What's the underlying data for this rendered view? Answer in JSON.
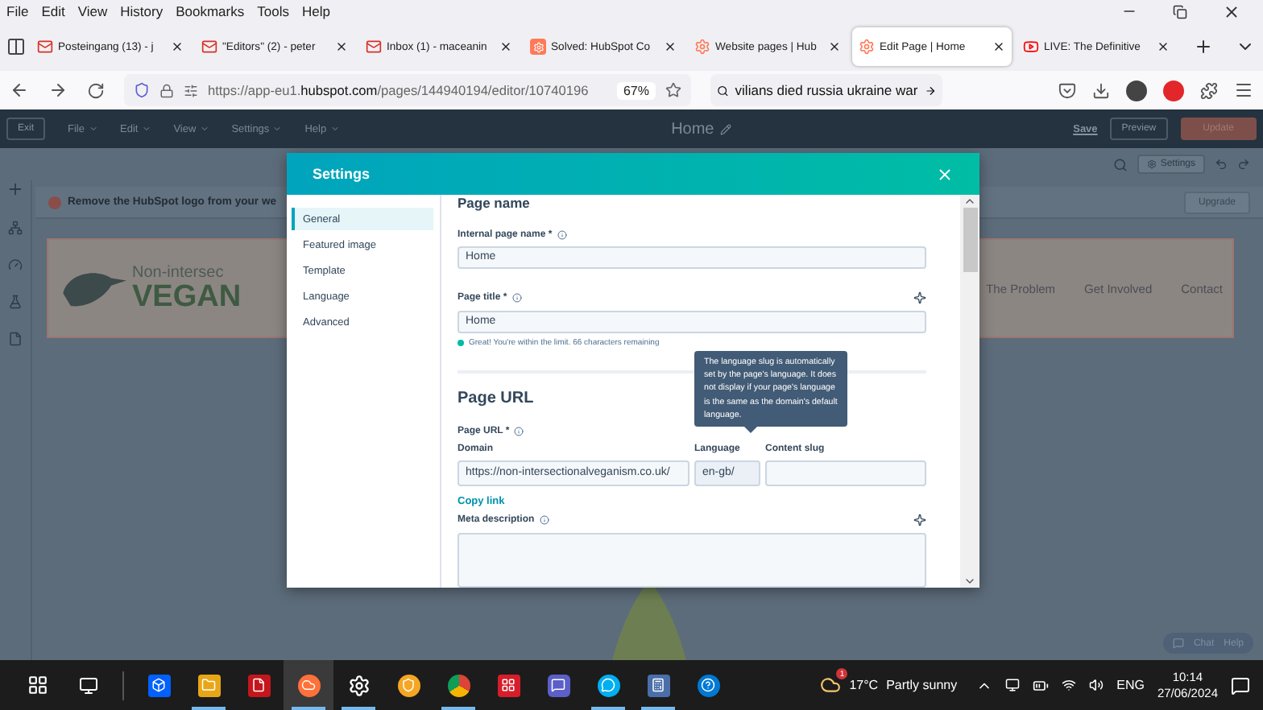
{
  "browser_menu": [
    "File",
    "Edit",
    "View",
    "History",
    "Bookmarks",
    "Tools",
    "Help"
  ],
  "tabs": [
    {
      "kind": "mail",
      "title": "Posteingang (13) - j",
      "selected": false
    },
    {
      "kind": "mail",
      "title": "\"Editors\" (2) - peter",
      "selected": false
    },
    {
      "kind": "mail",
      "title": "Inbox (1) - maceanin",
      "selected": false
    },
    {
      "kind": "hubspot-square",
      "title": "Solved: HubSpot Co",
      "selected": false
    },
    {
      "kind": "hubspot",
      "title": "Website pages | Hub",
      "selected": false
    },
    {
      "kind": "hubspot",
      "title": "Edit Page | Home",
      "selected": true
    },
    {
      "kind": "video",
      "title": "LIVE: The Definitive",
      "selected": false
    }
  ],
  "address_bar": {
    "prefix": "https://app-eu1.",
    "domain": "hubspot.com",
    "path": "/pages/144940194/editor/10740196",
    "zoom": "67%"
  },
  "search_field": {
    "value": "vilians died russia ukraine war"
  },
  "editor_toolbar": {
    "exit": "Exit",
    "menus": [
      "File",
      "Edit",
      "View",
      "Settings",
      "Help"
    ],
    "title": "Home",
    "save": "Save",
    "preview": "Preview",
    "update": "Update",
    "settings": "Settings"
  },
  "banner": {
    "text": "Remove the HubSpot logo from your we",
    "upgrade": "Upgrade"
  },
  "site_header": {
    "logo_top": "Non-intersec",
    "logo_bottom": "VEGAN",
    "nav": [
      "The Problem",
      "Get Involved",
      "Contact"
    ]
  },
  "chat_widget": {
    "chat": "Chat",
    "help": "Help"
  },
  "settings_dialog": {
    "title": "Settings",
    "nav": [
      {
        "label": "General",
        "selected": true
      },
      {
        "label": "Featured image",
        "selected": false
      },
      {
        "label": "Template",
        "selected": false
      },
      {
        "label": "Language",
        "selected": false
      },
      {
        "label": "Advanced",
        "selected": false
      }
    ],
    "page_name": {
      "heading": "Page name",
      "internal_label": "Internal page name *",
      "internal_value": "Home",
      "title_label": "Page title *",
      "title_value": "Home",
      "hint": "Great! You're within the limit. 66 characters remaining"
    },
    "page_url": {
      "heading": "Page URL",
      "label": "Page URL *",
      "domain_label": "Domain",
      "domain_value": "https://non-intersectionalveganism.co.uk/",
      "language_label": "Language",
      "language_value": "en-gb/",
      "slug_label": "Content slug",
      "copy_link": "Copy link"
    },
    "meta_label": "Meta description",
    "tooltip": "The language slug is automatically set by the page's language. It does not display if your page's language is the same as the domain's default language."
  },
  "taskbar": {
    "apps": [
      {
        "kind": "dropbox",
        "running": false
      },
      {
        "kind": "files",
        "running": true
      },
      {
        "kind": "pdf",
        "running": false
      },
      {
        "kind": "firefox",
        "running": true
      },
      {
        "kind": "settings",
        "running": true
      },
      {
        "kind": "vpn",
        "running": false
      },
      {
        "kind": "chrome",
        "running": true
      },
      {
        "kind": "mendeley",
        "running": false
      },
      {
        "kind": "teams",
        "running": false
      },
      {
        "kind": "skype",
        "running": true
      },
      {
        "kind": "calculator",
        "running": true
      },
      {
        "kind": "help",
        "running": false
      }
    ],
    "weather_badge": "1",
    "temperature": "17°C",
    "weather": "Partly sunny",
    "language": "ENG",
    "time": "10:14",
    "date": "27/06/2024"
  }
}
